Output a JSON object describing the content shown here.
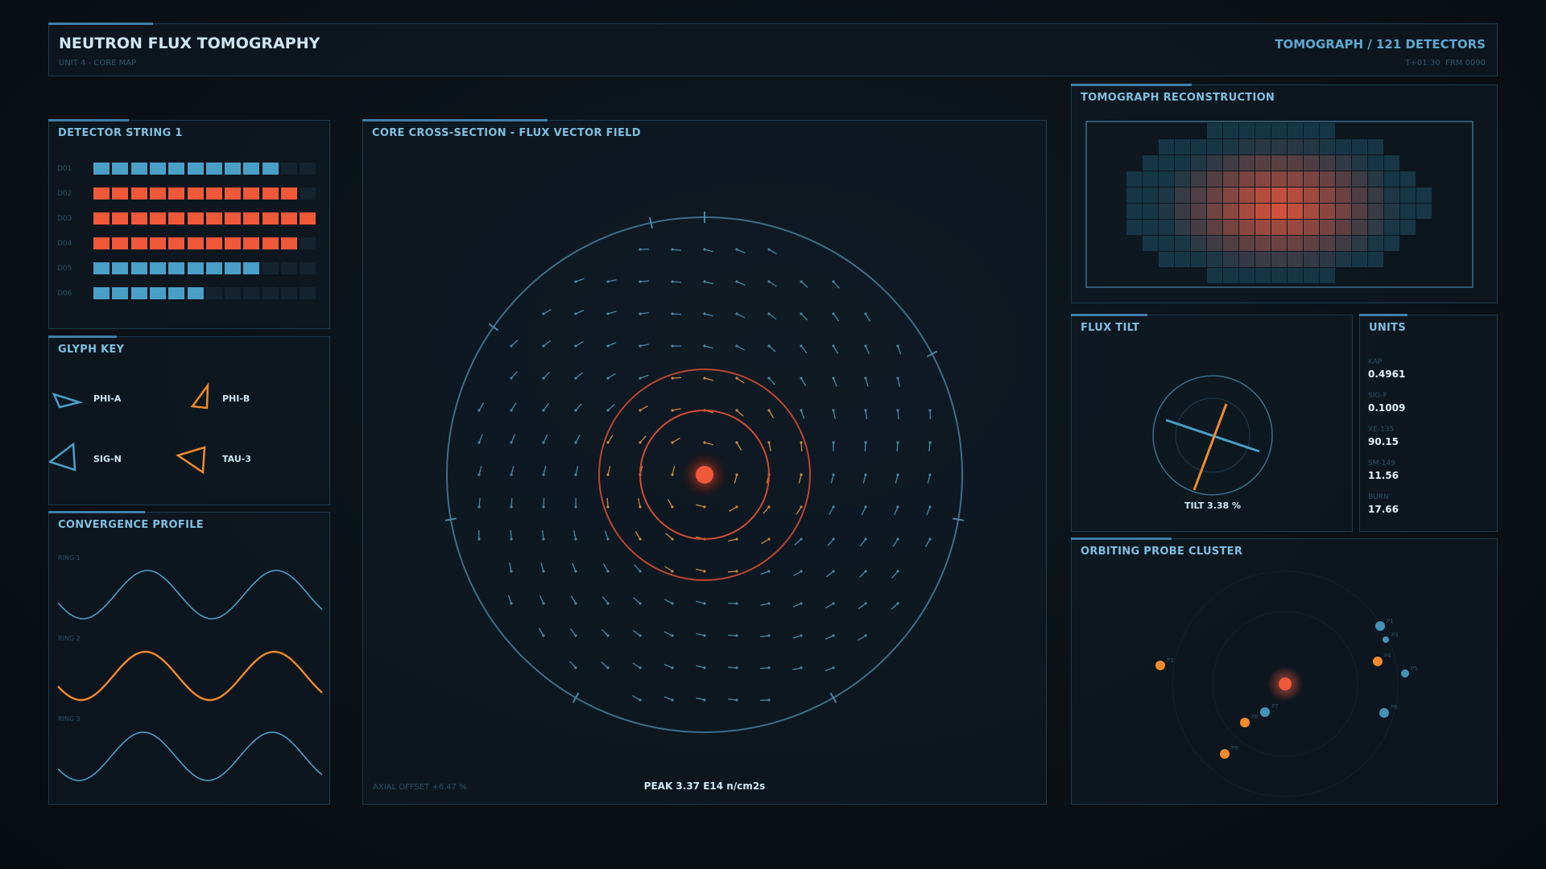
{
  "header": {
    "title": "NEUTRON FLUX TOMOGRAPHY",
    "subtitle": "UNIT 4 - CORE MAP",
    "mode": "TOMOGRAPH / 121 DETECTORS",
    "time": "T+01:30",
    "frame": "FRM 0090"
  },
  "detector_string": {
    "title": "DETECTOR STRING 1",
    "total_segments": 12,
    "rows": [
      {
        "label": "D01",
        "filled": 10,
        "state": "normal"
      },
      {
        "label": "D02",
        "filled": 11,
        "state": "high"
      },
      {
        "label": "D03",
        "filled": 12,
        "state": "high"
      },
      {
        "label": "D04",
        "filled": 11,
        "state": "high"
      },
      {
        "label": "D05",
        "filled": 9,
        "state": "normal"
      },
      {
        "label": "D06",
        "filled": 6,
        "state": "normal"
      }
    ]
  },
  "glyph_key": {
    "title": "GLYPH KEY",
    "items": [
      {
        "label": "PHI-A",
        "color": "#4a9fc7",
        "glyph": "triangle-right-icon"
      },
      {
        "label": "PHI-B",
        "color": "#f08a2c",
        "glyph": "triangle-up-icon"
      },
      {
        "label": "SIG-N",
        "color": "#4a9fc7",
        "glyph": "triangle-left-icon"
      },
      {
        "label": "TAU-3",
        "color": "#f08a2c",
        "glyph": "triangle-down-left-icon"
      }
    ]
  },
  "convergence": {
    "title": "CONVERGENCE PROFILE",
    "rings": [
      {
        "label": "RING 1",
        "color": "#4a9fc7"
      },
      {
        "label": "RING 2",
        "color": "#f08a2c"
      },
      {
        "label": "RING 3",
        "color": "#4a9fc7"
      }
    ]
  },
  "core": {
    "title": "CORE CROSS-SECTION - FLUX VECTOR FIELD",
    "axial_offset": "AXIAL OFFSET +6.47 %",
    "peak": "PEAK 3.37 E14 n/cm2s"
  },
  "tomograph": {
    "title": "TOMOGRAPH RECONSTRUCTION"
  },
  "flux_tilt": {
    "title": "FLUX TILT",
    "value_text": "TILT 3.38 %"
  },
  "units": {
    "title": "UNITS",
    "items": [
      {
        "label": "KAP",
        "value": "0.4961"
      },
      {
        "label": "SIG-F",
        "value": "0.1009"
      },
      {
        "label": "XE-135",
        "value": "90.15"
      },
      {
        "label": "SM-149",
        "value": "11.56"
      },
      {
        "label": "BURN",
        "value": "17.66"
      }
    ]
  },
  "probes": {
    "title": "ORBITING PROBE CLUSTER",
    "items": [
      {
        "label": "P1",
        "color": "#4a9fc7"
      },
      {
        "label": "P2",
        "color": "#f08a2c"
      },
      {
        "label": "P3",
        "color": "#4a9fc7"
      },
      {
        "label": "P4",
        "color": "#f08a2c"
      },
      {
        "label": "P5",
        "color": "#4a9fc7"
      },
      {
        "label": "P6",
        "color": "#4a9fc7"
      },
      {
        "label": "P7",
        "color": "#4a9fc7"
      },
      {
        "label": "P8",
        "color": "#f08a2c"
      },
      {
        "label": "P9",
        "color": "#f08a2c"
      }
    ]
  },
  "colors": {
    "accent": "#4a9fc7",
    "hot": "#f0583a",
    "warm": "#f08a2c",
    "border": "#1f3a4c"
  }
}
